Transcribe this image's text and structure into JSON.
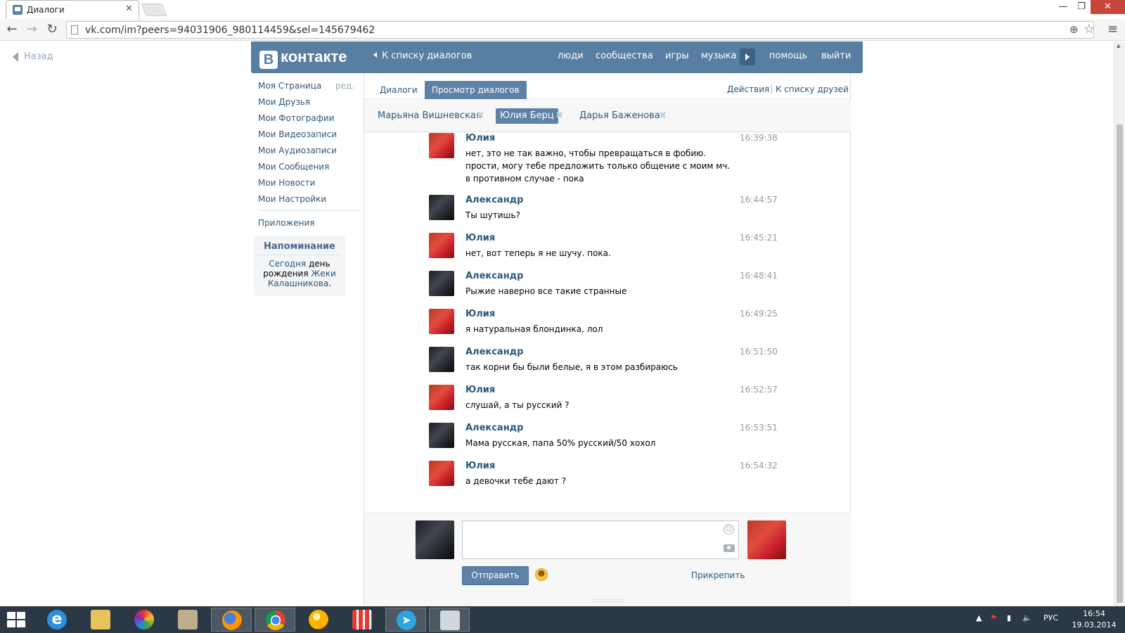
{
  "browser": {
    "tab_title": "Диалоги",
    "url": "vk.com/im?peers=94031906_980114459&sel=145679462"
  },
  "page": {
    "back_label": "Назад",
    "header": {
      "logo_letter": "В",
      "logo_text": "контакте",
      "back_to_dialogs": "К списку диалогов",
      "nav": [
        "люди",
        "сообщества",
        "игры",
        "музыка",
        "помощь",
        "выйти"
      ]
    },
    "left_menu": {
      "items": [
        "Моя Страница",
        "Мои Друзья",
        "Мои Фотографии",
        "Мои Видеозаписи",
        "Мои Аудиозаписи",
        "Мои Сообщения",
        "Мои Новости",
        "Мои Настройки"
      ],
      "edit": "ред.",
      "apps": "Приложения"
    },
    "reminder": {
      "title": "Напоминание",
      "part1": "Сегодня",
      "part2": " день рождения ",
      "link": "Жеки Калашникова",
      "end": "."
    },
    "tabs": {
      "dialogs": "Диалоги",
      "view_dialogs": "Просмотр диалогов",
      "actions": "Действия",
      "sep": "|",
      "to_friends": "К списку друзей"
    },
    "peers": [
      "Марьяна Вишневская",
      "Юлия Берц",
      "Дарья Баженова"
    ],
    "messages": [
      {
        "author": "Юлия",
        "text": "нет, это не так важно, чтобы превращаться в фобию. прости, могу тебе предложить только общение с моим мч. в противном случае - пока",
        "time": "16:39:38"
      },
      {
        "author": "Александр",
        "text": "Ты шутишь?",
        "time": "16:44:57"
      },
      {
        "author": "Юлия",
        "text": "нет, вот теперь я не шучу. пока.",
        "time": "16:45:21"
      },
      {
        "author": "Александр",
        "text": "Рыжие наверно все такие странные",
        "time": "16:48:41"
      },
      {
        "author": "Юлия",
        "text": "я натуральная блондинка, лол",
        "time": "16:49:25"
      },
      {
        "author": "Александр",
        "text": "так корни бы были белые, я в этом разбираюсь",
        "time": "16:51:50"
      },
      {
        "author": "Юлия",
        "text": "слушай, а ты русский ?",
        "time": "16:52:57"
      },
      {
        "author": "Александр",
        "text": "Мама русская, папа 50% русский/50 хохол",
        "time": "16:53:51"
      },
      {
        "author": "Юлия",
        "text": "а девочки тебе дают ?",
        "time": "16:54:32"
      }
    ],
    "composer": {
      "send": "Отправить",
      "attach": "Прикрепить",
      "input_value": ""
    }
  },
  "taskbar": {
    "lang": "РУС",
    "time": "16:54",
    "date": "19.03.2014"
  },
  "colors": {
    "vk_blue": "#587ea3",
    "link": "#2b587a",
    "taskbar": "#2b3845"
  }
}
